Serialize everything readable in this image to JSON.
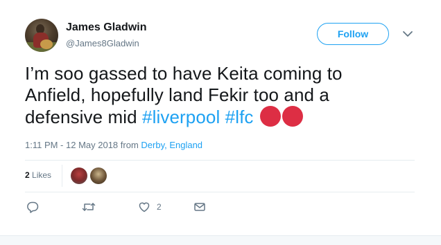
{
  "tweet": {
    "author": {
      "name": "James Gladwin",
      "handle": "@James8Gladwin"
    },
    "follow_label": "Follow",
    "text": {
      "line1": "I’m soo gassed to have Keita coming to",
      "line2": "Anfield, hopefully land Fekir too and a",
      "line3_prefix": "defensive mid ",
      "hashtag1": "#liverpool",
      "hashtag2": "#lfc",
      "emoji": [
        "red-circle",
        "red-circle"
      ]
    },
    "meta": {
      "time": "1:11 PM - 12 May 2018 from ",
      "location": "Derby, England"
    },
    "likes": {
      "count": "2",
      "label": "Likes"
    },
    "actions": {
      "like_count": "2"
    }
  },
  "icons": {
    "reply": "reply-icon",
    "retweet": "retweet-icon",
    "like": "heart-icon",
    "dm": "envelope-icon",
    "caret": "chevron-down-icon"
  },
  "colors": {
    "accent": "#1da1f2",
    "secondary_text": "#657786",
    "emoji_red": "#dd2e44"
  }
}
